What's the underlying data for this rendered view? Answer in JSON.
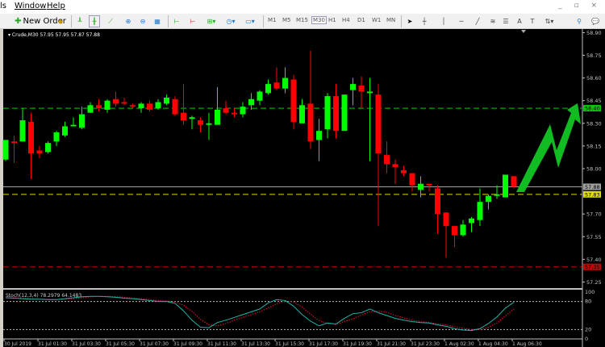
{
  "menu": {
    "items": [
      "ls",
      "Window",
      "Help"
    ],
    "window_controls": "_ ▫ ×"
  },
  "toolbar": {
    "new_order": "New Order",
    "periods": [
      "M1",
      "M5",
      "M15",
      "M30",
      "H1",
      "H4",
      "D1",
      "W1",
      "MN"
    ],
    "active_period": "M30"
  },
  "chart": {
    "header": "Crude,M30  57.95 57.95 57.87 57.88",
    "colors": {
      "bull": "#00ff00",
      "bear": "#ff0000",
      "bg": "#000000",
      "axis": "#c0c0c0",
      "stoch_main": "#20b2aa",
      "stoch_signal": "#cc1133",
      "arrow": "#11bb22"
    },
    "chart_data": [
      {
        "type": "candlestick",
        "symbol": "Crude",
        "timeframe": "M30",
        "ylim": [
          57.2,
          58.9
        ],
        "yticks": [
          58.9,
          58.75,
          58.6,
          58.45,
          58.3,
          58.15,
          58.0,
          57.7,
          57.55,
          57.4,
          57.25
        ],
        "xticks": [
          "30 Jul 2019",
          "31 Jul 01:30",
          "31 Jul 03:30",
          "31 Jul 05:30",
          "31 Jul 07:30",
          "31 Jul 09:30",
          "31 Jul 11:30",
          "31 Jul 13:30",
          "31 Jul 15:30",
          "31 Jul 17:30",
          "31 Jul 19:30",
          "31 Jul 21:30",
          "31 Jul 23:30",
          "1 Aug 02:30",
          "1 Aug 04:30",
          "1 Aug 06:30"
        ],
        "ohlc": [
          [
            58.06,
            58.19,
            58.05,
            58.19
          ],
          [
            58.18,
            58.22,
            58.04,
            58.17
          ],
          [
            58.18,
            58.4,
            58.18,
            58.32
          ],
          [
            58.31,
            58.37,
            57.93,
            58.1
          ],
          [
            58.12,
            58.15,
            58.07,
            58.1
          ],
          [
            58.11,
            58.18,
            58.1,
            58.17
          ],
          [
            58.18,
            58.25,
            58.15,
            58.24
          ],
          [
            58.22,
            58.31,
            58.21,
            58.28
          ],
          [
            58.28,
            58.34,
            58.28,
            58.29
          ],
          [
            58.27,
            58.41,
            58.26,
            58.36
          ],
          [
            58.37,
            58.44,
            58.37,
            58.42
          ],
          [
            58.42,
            58.46,
            58.38,
            58.4
          ],
          [
            58.39,
            58.46,
            58.37,
            58.45
          ],
          [
            58.46,
            58.51,
            58.41,
            58.43
          ],
          [
            58.44,
            58.47,
            58.42,
            58.43
          ],
          [
            58.42,
            58.43,
            58.4,
            58.41
          ],
          [
            58.4,
            58.44,
            58.37,
            58.43
          ],
          [
            58.43,
            58.45,
            58.38,
            58.39
          ],
          [
            58.4,
            58.46,
            58.39,
            58.44
          ],
          [
            58.43,
            58.49,
            58.42,
            58.47
          ],
          [
            58.46,
            58.48,
            58.35,
            58.36
          ],
          [
            58.37,
            58.56,
            58.29,
            58.32
          ],
          [
            58.33,
            58.35,
            58.26,
            58.34
          ],
          [
            58.32,
            58.34,
            58.24,
            58.29
          ],
          [
            58.29,
            58.37,
            58.19,
            58.3
          ],
          [
            58.29,
            58.54,
            58.29,
            58.39
          ],
          [
            58.4,
            58.45,
            58.36,
            58.37
          ],
          [
            58.37,
            58.4,
            58.34,
            58.36
          ],
          [
            58.36,
            58.44,
            58.34,
            58.41
          ],
          [
            58.42,
            58.5,
            58.39,
            58.46
          ],
          [
            58.45,
            58.52,
            58.42,
            58.51
          ],
          [
            58.5,
            58.59,
            58.49,
            58.56
          ],
          [
            58.57,
            58.67,
            58.52,
            58.53
          ],
          [
            58.53,
            58.67,
            58.5,
            58.6
          ],
          [
            58.59,
            58.62,
            58.26,
            58.31
          ],
          [
            58.3,
            58.46,
            58.3,
            58.42
          ],
          [
            58.43,
            58.78,
            58.13,
            58.18
          ],
          [
            58.19,
            58.33,
            58.05,
            58.25
          ],
          [
            58.26,
            58.5,
            58.2,
            58.48
          ],
          [
            58.48,
            58.56,
            58.2,
            58.25
          ],
          [
            58.25,
            58.49,
            58.25,
            58.49
          ],
          [
            58.52,
            58.6,
            58.42,
            58.56
          ],
          [
            58.55,
            58.61,
            58.4,
            58.51
          ],
          [
            58.5,
            58.6,
            58.05,
            58.51
          ],
          [
            58.49,
            58.56,
            57.62,
            58.1
          ],
          [
            58.09,
            58.18,
            57.97,
            58.03
          ],
          [
            58.03,
            58.06,
            57.9,
            58.01
          ],
          [
            57.99,
            58.02,
            57.95,
            57.97
          ],
          [
            57.97,
            57.97,
            57.85,
            57.89
          ],
          [
            57.86,
            57.95,
            57.81,
            57.9
          ],
          [
            57.9,
            57.9,
            57.85,
            57.89
          ],
          [
            57.87,
            57.89,
            57.57,
            57.7
          ],
          [
            57.71,
            57.71,
            57.41,
            57.62
          ],
          [
            57.62,
            57.62,
            57.48,
            57.56
          ],
          [
            57.56,
            57.66,
            57.55,
            57.63
          ],
          [
            57.64,
            57.68,
            57.58,
            57.67
          ],
          [
            57.66,
            57.87,
            57.62,
            57.78
          ],
          [
            57.78,
            57.83,
            57.73,
            57.82
          ],
          [
            57.82,
            57.89,
            57.8,
            57.83
          ],
          [
            57.81,
            57.96,
            57.81,
            57.96
          ],
          [
            57.95,
            57.95,
            57.87,
            57.88
          ]
        ],
        "levels": [
          {
            "price": 58.4,
            "label": "58.40",
            "color": "#00cc00",
            "style": "dashed"
          },
          {
            "price": 57.88,
            "label": "57.88",
            "color": "#a0a0a0",
            "style": "solid"
          },
          {
            "price": 57.83,
            "label": "57.83",
            "color": "#dddd00",
            "style": "dashed"
          },
          {
            "price": 57.35,
            "label": "57.35",
            "color": "#cc0000",
            "style": "dashed"
          }
        ]
      },
      {
        "type": "line",
        "indicator": "Stoch(12,3,4)",
        "label": "Stoch(12,3,4) 78.2979 64.1483",
        "ylim": [
          0,
          100
        ],
        "yticks": [
          100,
          80,
          20,
          0
        ],
        "levels": [
          80,
          20
        ],
        "main": [
          88,
          87,
          86,
          85,
          85,
          84,
          84,
          86,
          88,
          90,
          91,
          91,
          90,
          89,
          87,
          86,
          84,
          82,
          80,
          80,
          76,
          60,
          40,
          25,
          24,
          35,
          40,
          46,
          52,
          58,
          64,
          77,
          84,
          82,
          70,
          52,
          38,
          28,
          34,
          32,
          44,
          54,
          56,
          64,
          56,
          50,
          44,
          40,
          37,
          35,
          34,
          30,
          27,
          22,
          19,
          18,
          22,
          33,
          47,
          66,
          78.2979
        ],
        "signal": [
          88,
          88,
          87,
          86,
          85,
          85,
          84,
          85,
          86,
          88,
          90,
          91,
          91,
          90,
          89,
          87,
          86,
          84,
          82,
          81,
          79,
          72,
          59,
          42,
          30,
          28,
          33,
          40,
          46,
          52,
          58,
          66,
          75,
          81,
          79,
          68,
          53,
          39,
          33,
          31,
          37,
          43,
          51,
          58,
          59,
          57,
          50,
          45,
          40,
          37,
          35,
          32,
          30,
          26,
          23,
          20,
          20,
          25,
          34,
          49,
          64.1483
        ]
      }
    ]
  }
}
